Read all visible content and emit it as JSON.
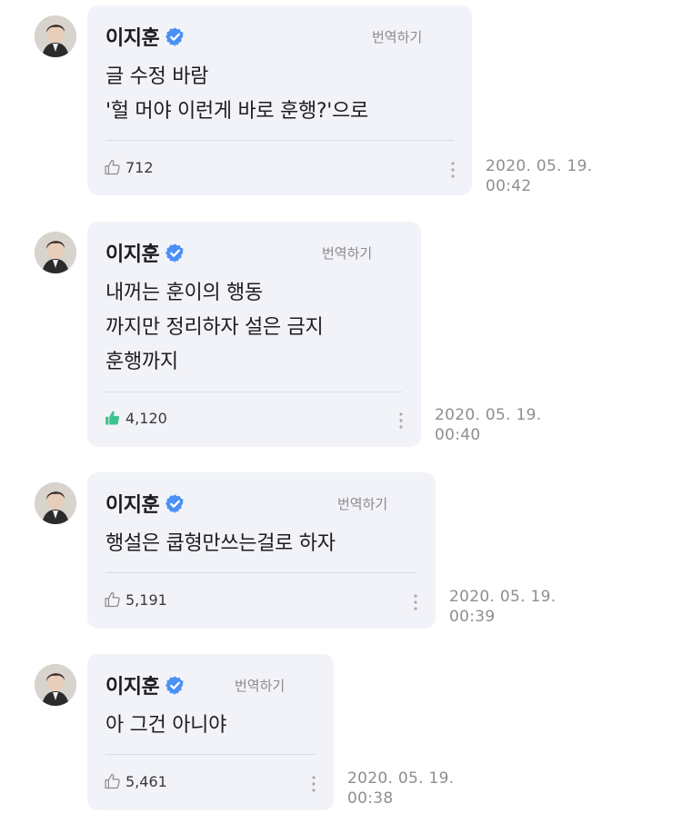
{
  "colors": {
    "bubble_bg": "#f2f3f8",
    "verified_blue": "#4a90f5",
    "liked_green": "#3fc38e",
    "muted_text": "#8e8e93"
  },
  "messages": [
    {
      "author": "이지훈",
      "translate_label": "번역하기",
      "text": "글 수정 바람\n'헐 머야 이런게 바로 훈행?'으로",
      "likes": "712",
      "liked": false,
      "date": "2020. 05. 19.",
      "time": "00:42"
    },
    {
      "author": "이지훈",
      "translate_label": "번역하기",
      "text": "내꺼는 훈이의 행동\n까지만 정리하자 설은 금지\n훈행까지",
      "likes": "4,120",
      "liked": true,
      "date": "2020. 05. 19.",
      "time": "00:40"
    },
    {
      "author": "이지훈",
      "translate_label": "번역하기",
      "text": "행설은 쿱형만쓰는걸로 하자",
      "likes": "5,191",
      "liked": false,
      "date": "2020. 05. 19.",
      "time": "00:39"
    },
    {
      "author": "이지훈",
      "translate_label": "번역하기",
      "text": "아 그건 아니야",
      "likes": "5,461",
      "liked": false,
      "date": "2020. 05. 19.",
      "time": "00:38"
    }
  ]
}
